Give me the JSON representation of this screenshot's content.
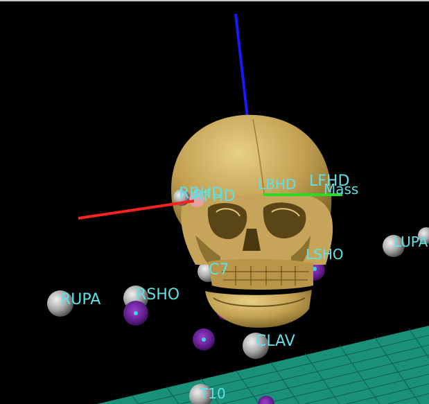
{
  "viewport": {
    "background": "#000000",
    "floor_color": "#1a8f7a",
    "grid_line_color": "#0e5f52"
  },
  "axes": {
    "x_color": "#ff2020",
    "y_color": "#20e020",
    "z_color": "#1818ff"
  },
  "skull": {
    "color": "#c9a85a",
    "shadow": "#7a6226"
  },
  "markers": {
    "sphere_color": "#c8c8c8",
    "joint_color": "#7a1ea8",
    "joint_core": "#39d6e0"
  },
  "labels": {
    "rbhd": "RBHD",
    "rfhd": "RFHD",
    "lbhd": "LBHD",
    "lfhd": "LFHD",
    "mass": "Mass",
    "lupa": "LUPA",
    "lsho": "LSHO",
    "c7": "C7",
    "rupa": "RUPA",
    "rsho": "RSHO",
    "clav": "CLAV",
    "t10": "T10"
  }
}
